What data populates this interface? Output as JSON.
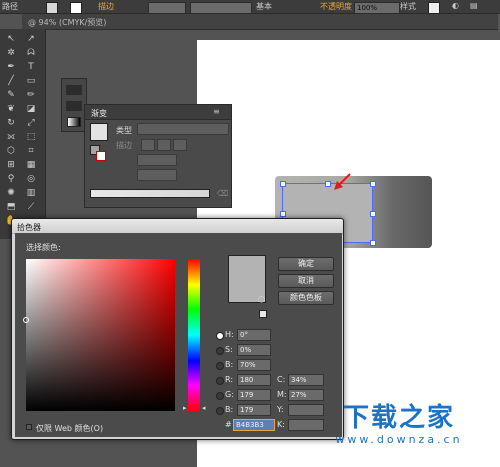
{
  "control_bar": {
    "left_label": "路径",
    "stroke_label": "描边",
    "stroke_style": "基本",
    "opacity_label": "不透明度",
    "opacity_value": "100%",
    "style_label": "样式"
  },
  "document_tab": {
    "label": "@ 94% (CMYK/预览)"
  },
  "gradient_panel": {
    "title": "渐变",
    "type_label": "类型",
    "stroke_label": "描边"
  },
  "color_picker": {
    "title": "拾色器",
    "select_color_label": "选择颜色:",
    "ok_button": "确定",
    "cancel_button": "取消",
    "swatches_button": "颜色色板",
    "h_label": "H:",
    "h_value": "0°",
    "s_label": "S:",
    "s_value": "0%",
    "b_label": "B:",
    "b_value": "70%",
    "r_label": "R:",
    "r_value": "180",
    "g_label": "G:",
    "g_value": "179",
    "b2_label": "B:",
    "b2_value": "179",
    "c_label": "C:",
    "c_value": "34%",
    "m_label": "M:",
    "m_value": "27%",
    "y_label": "Y:",
    "k_label": "K:",
    "hex_prefix": "#",
    "hex_value": "B4B3B3",
    "web_only_label": "仅限 Web 颜色(O)",
    "swatch_color": "#b4b3b3"
  },
  "watermark": {
    "title": "下载之家",
    "url": "www.downza.cn",
    "color": "#1a73c4"
  }
}
